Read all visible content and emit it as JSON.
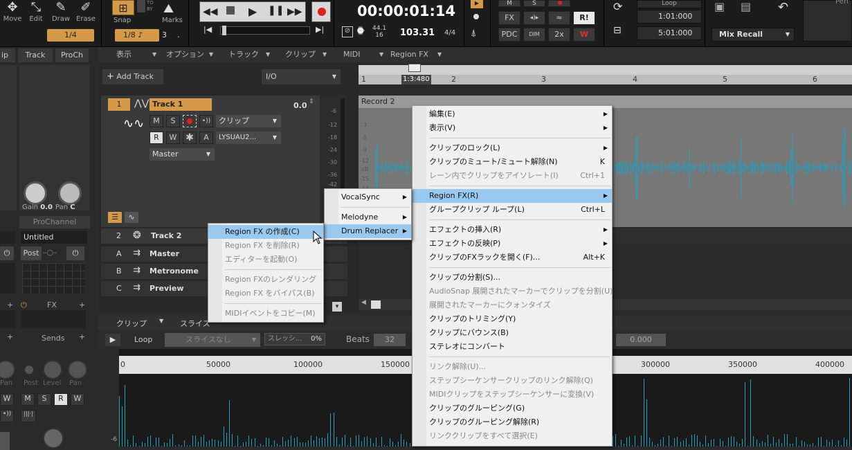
{
  "toolbar": {
    "tools": [
      "Move",
      "Edit",
      "Draw",
      "Erase"
    ],
    "snap_value_1": "1/4",
    "snap_label": "Snap",
    "snap_value_2": "1/8",
    "snap_num": "3",
    "marks_label": "Marks",
    "time": "00:00:01:14",
    "sample_rate": "44.1",
    "bit_depth": "16",
    "tempo": "103.31",
    "meter": "4/4",
    "fx_labels": [
      "M",
      "S",
      "FX",
      "R!",
      "PDC",
      "DIM",
      "2x"
    ],
    "loop_label": "Loop",
    "loop_start": "1:01:000",
    "loop_end": "5:01:000",
    "mix_recall": "Mix Recall",
    "perf_label": "Perf"
  },
  "left": {
    "tabs": [
      "ip",
      "Track",
      "ProCh"
    ],
    "gain_label": "Gain",
    "gain_value": "0.0",
    "pan_label": "Pan",
    "pan_value": "C",
    "prochannel_label": "ProChannel",
    "preset_name": "Untitled",
    "post_label": "Post",
    "fx_label": "FX",
    "sends_label": "Sends",
    "send_post": "Post",
    "send_level": "Level",
    "send_pan": "Pan",
    "pan_small": "Pan",
    "mix_letters": [
      "M",
      "S",
      "R",
      "W"
    ]
  },
  "track_view": {
    "menus": [
      "表示",
      "オプション",
      "トラック",
      "クリップ",
      "MIDI",
      "Region FX"
    ],
    "add_track": "Add Track",
    "io_select": "I/O",
    "ruler": [
      "1",
      "1:3:480",
      "2",
      "3",
      "4",
      "5",
      "6"
    ],
    "track1": {
      "num": "1",
      "name": "Track 1",
      "volume": "0.0",
      "clip_select": "クリップ",
      "input_select": "LYSUAU2...",
      "output": "Master",
      "btns": [
        "M",
        "S",
        "R",
        "W",
        "A"
      ]
    },
    "track2": {
      "num": "2",
      "name": "Track 2"
    },
    "clip_name": "Record 2",
    "meter_scale": [
      "-6",
      "-12",
      "-18",
      "-24",
      "-30",
      "-36",
      "-42"
    ],
    "clip_scale": [
      "-3",
      "-6",
      "-9",
      "-12",
      "dB",
      "-15",
      "-18"
    ],
    "buses": [
      {
        "letter": "A",
        "name": "Master"
      },
      {
        "letter": "B",
        "name": "Metronome"
      },
      {
        "letter": "C",
        "name": "Preview"
      }
    ]
  },
  "bottom": {
    "tabs": [
      "クリップ",
      "スライス"
    ],
    "loop_label": "Loop",
    "slice_select": "スライスなし",
    "slice_slider_label": "スレッシ...",
    "slice_slider_value": "0%",
    "beats_label": "Beats",
    "beats_value": "32",
    "field_value": "0.000",
    "ruler": [
      "0",
      "50000",
      "100000",
      "150000",
      "300000",
      "350000",
      "400000"
    ],
    "db_label": "-6"
  },
  "context_menu": {
    "items": [
      {
        "label": "編集(E)",
        "arrow": true
      },
      {
        "label": "表示(V)",
        "arrow": true
      },
      {
        "sep": true
      },
      {
        "label": "クリップのロック(L)",
        "arrow": true
      },
      {
        "label": "クリップのミュート/ミュート解除(N)",
        "shortcut": "K"
      },
      {
        "label": "レーン内でクリップをアイソレート(I)",
        "shortcut": "Ctrl+1",
        "disabled": true
      },
      {
        "sep": true
      },
      {
        "label": "Region FX(R)",
        "arrow": true,
        "highlight": true
      },
      {
        "label": "グループクリップ ループ(L)",
        "shortcut": "Ctrl+L"
      },
      {
        "sep": true
      },
      {
        "label": "エフェクトの挿入(R)",
        "arrow": true
      },
      {
        "label": "エフェクトの反映(P)",
        "arrow": true
      },
      {
        "label": "クリップのFXラックを開く(F)...",
        "shortcut": "Alt+K"
      },
      {
        "sep": true
      },
      {
        "label": "クリップの分割(S)..."
      },
      {
        "label": "AudioSnap 展開されたマーカーでクリップを分割(U)",
        "disabled": true
      },
      {
        "label": "展開されたマーカーにクォンタイズ",
        "disabled": true
      },
      {
        "label": "クリップのトリミング(Y)"
      },
      {
        "label": "クリップにバウンス(B)"
      },
      {
        "label": "ステレオにコンバート"
      },
      {
        "sep": true
      },
      {
        "label": "リンク解除(U)...",
        "disabled": true
      },
      {
        "label": "ステップシーケンサークリップのリンク解除(Q)",
        "disabled": true
      },
      {
        "label": "MIDIクリップをステップシーケンサーに変換(V)",
        "disabled": true
      },
      {
        "label": "クリップのグルーピング(G)"
      },
      {
        "label": "クリップのグルーピング解除(R)"
      },
      {
        "label": "リンククリップをすべて選択(E)",
        "disabled": true
      }
    ]
  },
  "region_fx_menu": {
    "items": [
      {
        "label": "VocalSync",
        "arrow": true
      },
      {
        "sep": true
      },
      {
        "label": "Melodyne",
        "arrow": true
      },
      {
        "label": "Drum Replacer",
        "arrow": true,
        "highlight": true
      }
    ]
  },
  "drum_menu": {
    "items": [
      {
        "label": "Region FX の作成(C)",
        "highlight": true
      },
      {
        "label": "Region FX を削除(R)",
        "disabled": true
      },
      {
        "label": "エディターを起動(O)",
        "disabled": true
      },
      {
        "sep": true
      },
      {
        "label": "Region FXのレンダリング",
        "disabled": true
      },
      {
        "label": "Region FX をバイパス(B)",
        "disabled": true
      },
      {
        "sep": true
      },
      {
        "label": "MIDIイベントをコピー(M)",
        "disabled": true
      }
    ]
  }
}
